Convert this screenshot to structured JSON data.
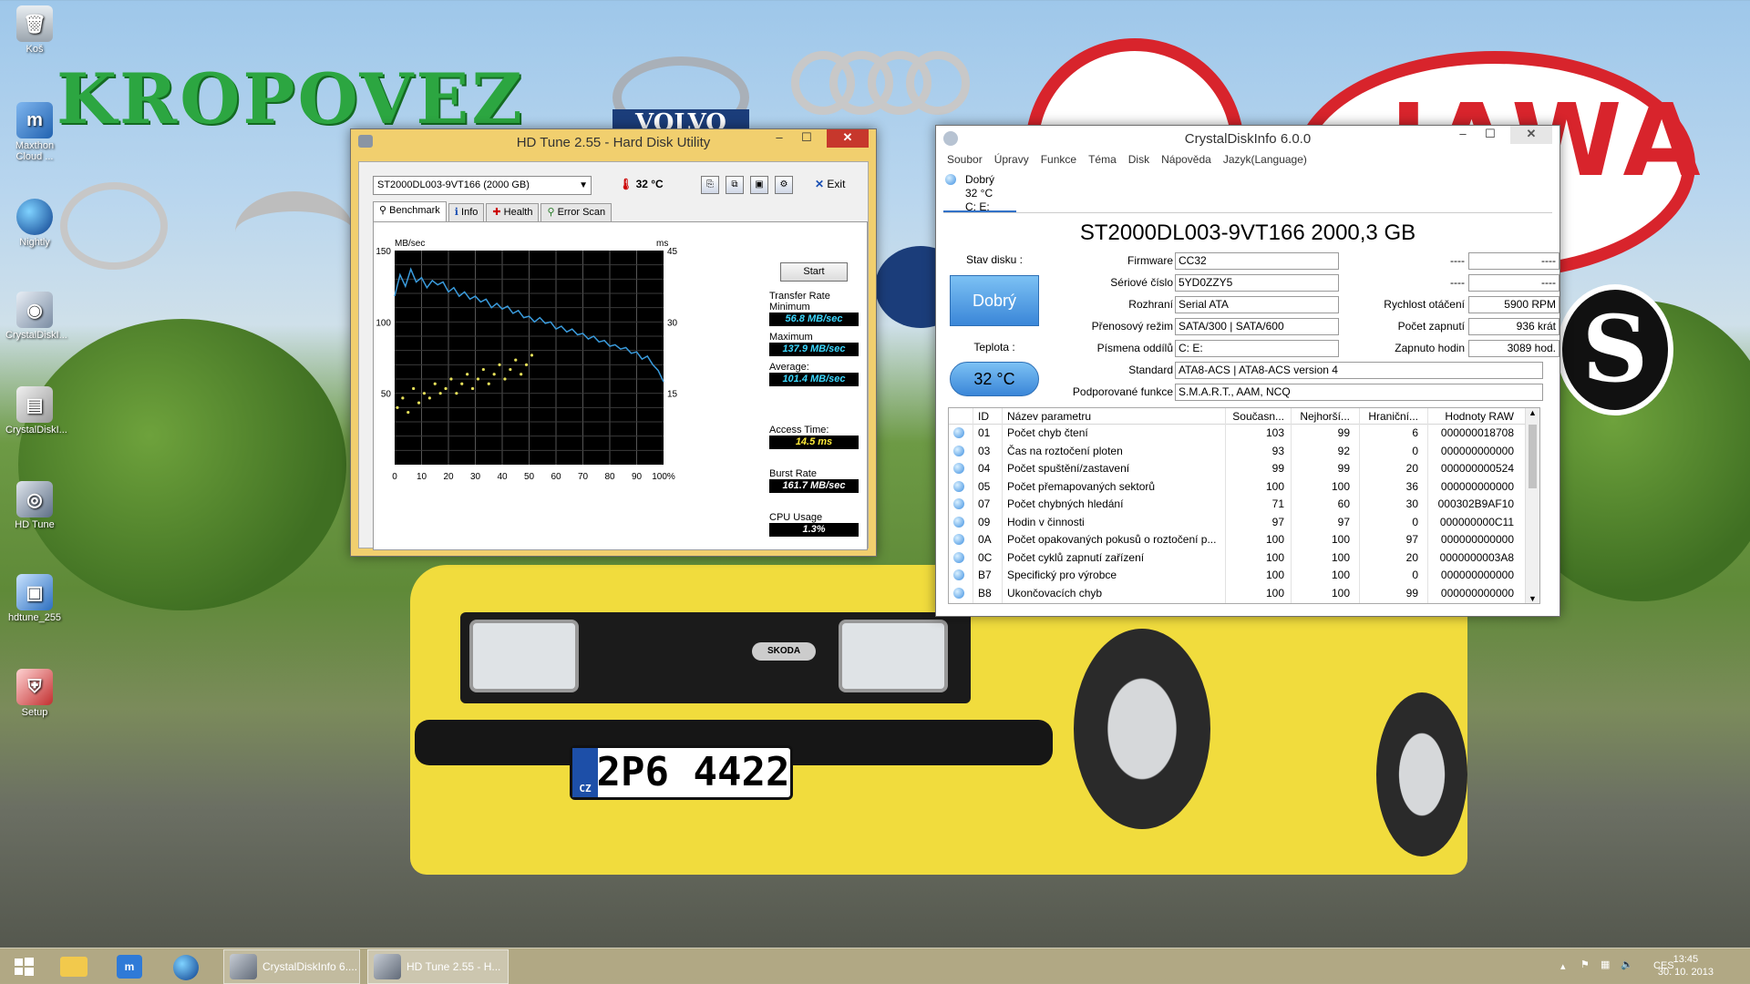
{
  "desktop": {
    "brand_text": "KROPOVEZ",
    "logo_text_volvo": "VOLVO",
    "logo_text_jawa": "JAWA",
    "logo_text_skoda": "SKODA",
    "plate_text": "2P6 4422",
    "plate_country": "CZ",
    "icons": [
      {
        "label": "Koš",
        "icon": "recycle-bin-icon"
      },
      {
        "label": "Maxthon Cloud ...",
        "icon": "maxthon-icon"
      },
      {
        "label": "Nightly",
        "icon": "nightly-icon"
      },
      {
        "label": "CrystalDiskI...",
        "icon": "crystaldisk-icon"
      },
      {
        "label": "CrystalDiskI...",
        "icon": "crystaldisk-icon"
      },
      {
        "label": "HD Tune",
        "icon": "hdtune-icon"
      },
      {
        "label": "hdtune_255",
        "icon": "installer-icon"
      },
      {
        "label": "Setup",
        "icon": "setup-icon"
      }
    ]
  },
  "hdtune": {
    "title": "HD Tune 2.55 - Hard Disk Utility",
    "drive": "ST2000DL003-9VT166 (2000 GB)",
    "temperature": "32 °C",
    "exit_label": "Exit",
    "tabs": [
      "Benchmark",
      "Info",
      "Health",
      "Error Scan"
    ],
    "start_label": "Start",
    "transfer_rate_label": "Transfer Rate",
    "minimum_label": "Minimum",
    "minimum_value": "56.8 MB/sec",
    "maximum_label": "Maximum",
    "maximum_value": "137.9 MB/sec",
    "average_label": "Average:",
    "average_value": "101.4 MB/sec",
    "access_time_label": "Access Time:",
    "access_time_value": "14.5 ms",
    "burst_rate_label": "Burst Rate",
    "burst_rate_value": "161.7 MB/sec",
    "cpu_usage_label": "CPU Usage",
    "cpu_usage_value": "1.3%"
  },
  "chart_data": {
    "type": "line",
    "title": "",
    "xlabel": "",
    "ylabel": "MB/sec",
    "y2label": "ms",
    "x_ticks": [
      "0",
      "10",
      "20",
      "30",
      "40",
      "50",
      "60",
      "70",
      "80",
      "90",
      "100%"
    ],
    "y_ticks": [
      "150",
      "100",
      "50"
    ],
    "y2_ticks": [
      "45",
      "30",
      "15"
    ],
    "xlim": [
      0,
      100
    ],
    "ylim": [
      0,
      150
    ],
    "y2lim": [
      0,
      45
    ],
    "grid": true,
    "series": [
      {
        "color": "#3a9bdc",
        "x": [
          0,
          2,
          4,
          6,
          8,
          10,
          12,
          14,
          16,
          18,
          20,
          22,
          24,
          26,
          28,
          30,
          32,
          34,
          36,
          38,
          40,
          42,
          44,
          46,
          48,
          50,
          52,
          54,
          56,
          58,
          60,
          62,
          64,
          66,
          68,
          70,
          72,
          74,
          76,
          78,
          80,
          82,
          84,
          86,
          88,
          90,
          92,
          94,
          96,
          98,
          100
        ],
        "y": [
          118,
          133,
          125,
          137,
          128,
          131,
          124,
          129,
          126,
          128,
          121,
          124,
          118,
          121,
          116,
          118,
          114,
          116,
          110,
          113,
          109,
          111,
          106,
          108,
          103,
          104,
          100,
          103,
          99,
          100,
          95,
          97,
          93,
          95,
          91,
          92,
          88,
          90,
          86,
          87,
          83,
          84,
          81,
          82,
          78,
          79,
          74,
          76,
          70,
          66,
          58
        ]
      },
      {
        "color": "#e6e05a",
        "x": [
          1,
          3,
          5,
          7,
          9,
          11,
          13,
          15,
          17,
          19,
          21,
          23,
          25,
          27,
          29,
          31,
          33,
          35,
          37,
          39,
          41,
          43,
          45,
          47,
          49,
          51
        ],
        "y": [
          12,
          14,
          11,
          16,
          13,
          15,
          14,
          17,
          15,
          16,
          18,
          15,
          17,
          19,
          16,
          18,
          20,
          17,
          19,
          21,
          18,
          20,
          22,
          19,
          21,
          23
        ],
        "axis": "right"
      }
    ]
  },
  "cdi": {
    "title": "CrystalDiskInfo 6.0.0",
    "menu": [
      "Soubor",
      "Úpravy",
      "Funkce",
      "Téma",
      "Disk",
      "Nápověda",
      "Jazyk(Language)"
    ],
    "disk_tab": {
      "status": "Dobrý",
      "temp": "32 °C",
      "drive": "C: E:"
    },
    "model": "ST2000DL003-9VT166 2000,3 GB",
    "health_label": "Stav disku :",
    "health_value": "Dobrý",
    "temp_label": "Teplota :",
    "temp_value": "32 °C",
    "firmware_label": "Firmware",
    "firmware_value": "CC32",
    "serial_label": "Sériové číslo",
    "serial_value": "5YD0ZZY5",
    "interface_label": "Rozhraní",
    "interface_value": "Serial ATA",
    "transfer_label": "Přenosový režim",
    "transfer_value": "SATA/300 | SATA/600",
    "letters_label": "Písmena oddílů",
    "letters_value": "C: E:",
    "standard_label": "Standard",
    "standard_value": "ATA8-ACS | ATA8-ACS version 4",
    "features_label": "Podporované funkce",
    "features_value": "S.M.A.R.T., AAM, NCQ",
    "right_blank_1": "----",
    "right_blank_1v": "----",
    "right_blank_2": "----",
    "right_blank_2v": "----",
    "rpm_label": "Rychlost otáčení",
    "rpm_value": "5900 RPM",
    "power_count_label": "Počet zapnutí",
    "power_count_value": "936 krát",
    "power_hours_label": "Zapnuto hodin",
    "power_hours_value": "3089 hod.",
    "smart_headers": [
      "ID",
      "Název parametru",
      "Současn...",
      "Nejhorší...",
      "Hraniční...",
      "Hodnoty RAW"
    ],
    "smart_rows": [
      [
        "01",
        "Počet chyb čtení",
        "103",
        "99",
        "6",
        "000000018708"
      ],
      [
        "03",
        "Čas na roztočení ploten",
        "93",
        "92",
        "0",
        "000000000000"
      ],
      [
        "04",
        "Počet spuštění/zastavení",
        "99",
        "99",
        "20",
        "000000000524"
      ],
      [
        "05",
        "Počet přemapovaných sektorů",
        "100",
        "100",
        "36",
        "000000000000"
      ],
      [
        "07",
        "Počet chybných hledání",
        "71",
        "60",
        "30",
        "000302B9AF10"
      ],
      [
        "09",
        "Hodin v činnosti",
        "97",
        "97",
        "0",
        "000000000C11"
      ],
      [
        "0A",
        "Počet opakovaných pokusů o roztočení p...",
        "100",
        "100",
        "97",
        "000000000000"
      ],
      [
        "0C",
        "Počet cyklů zapnutí zařízení",
        "100",
        "100",
        "20",
        "0000000003A8"
      ],
      [
        "B7",
        "Specifický pro výrobce",
        "100",
        "100",
        "0",
        "000000000000"
      ],
      [
        "B8",
        "Ukončovacích chyb",
        "100",
        "100",
        "99",
        "000000000000"
      ]
    ]
  },
  "taskbar": {
    "apps": [
      {
        "label": "CrystalDiskInfo 6....",
        "icon": "crystaldisk-icon"
      },
      {
        "label": "HD Tune 2.55 - H...",
        "icon": "hdtune-icon"
      }
    ],
    "language": "CES",
    "time": "13:45",
    "date": "30. 10. 2013"
  }
}
